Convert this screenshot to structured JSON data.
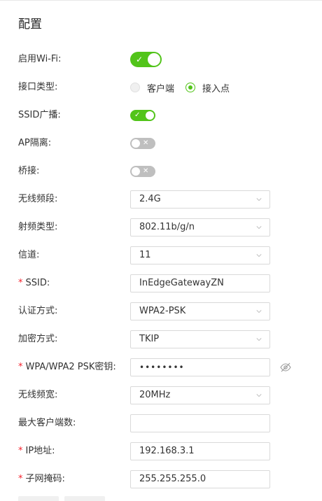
{
  "page": {
    "title": "配置"
  },
  "form": {
    "wifi_enable": {
      "label": "启用Wi-Fi:",
      "value": "on"
    },
    "interface_type": {
      "label": "接口类型:",
      "options": [
        "客户端",
        "接入点"
      ],
      "selected": "接入点"
    },
    "ssid_broadcast": {
      "label": "SSID广播:",
      "value": "on"
    },
    "ap_isolation": {
      "label": "AP隔离:",
      "value": "off"
    },
    "bridge": {
      "label": "桥接:",
      "value": "off"
    },
    "band": {
      "label": "无线频段:",
      "value": "2.4G"
    },
    "rf_type": {
      "label": "射频类型:",
      "value": "802.11b/g/n"
    },
    "channel": {
      "label": "信道:",
      "value": "11"
    },
    "ssid": {
      "required": "*",
      "label": "SSID:",
      "value": "InEdgeGatewayZN"
    },
    "auth_method": {
      "label": "认证方式:",
      "value": "WPA2-PSK"
    },
    "encryption": {
      "label": "加密方式:",
      "value": "TKIP"
    },
    "psk": {
      "required": "*",
      "label": "WPA/WPA2 PSK密钥:",
      "value": "••••••••"
    },
    "bandwidth": {
      "label": "无线频宽:",
      "value": "20MHz"
    },
    "max_clients": {
      "label": "最大客户端数:",
      "value": ""
    },
    "ip": {
      "required": "*",
      "label": "IP地址:",
      "value": "192.168.3.1"
    },
    "subnet_mask": {
      "required": "*",
      "label": "子网掩码:",
      "value": "255.255.255.0"
    }
  },
  "icons": {
    "check": "✓",
    "cross": "✕",
    "dropdown": "chevron-down-icon",
    "password_toggle": "eye-slash-icon"
  },
  "colors": {
    "switch_on": "#52c41a",
    "switch_off": "#bfbfbf",
    "required": "#f5222d",
    "border": "#d9d9d9"
  }
}
